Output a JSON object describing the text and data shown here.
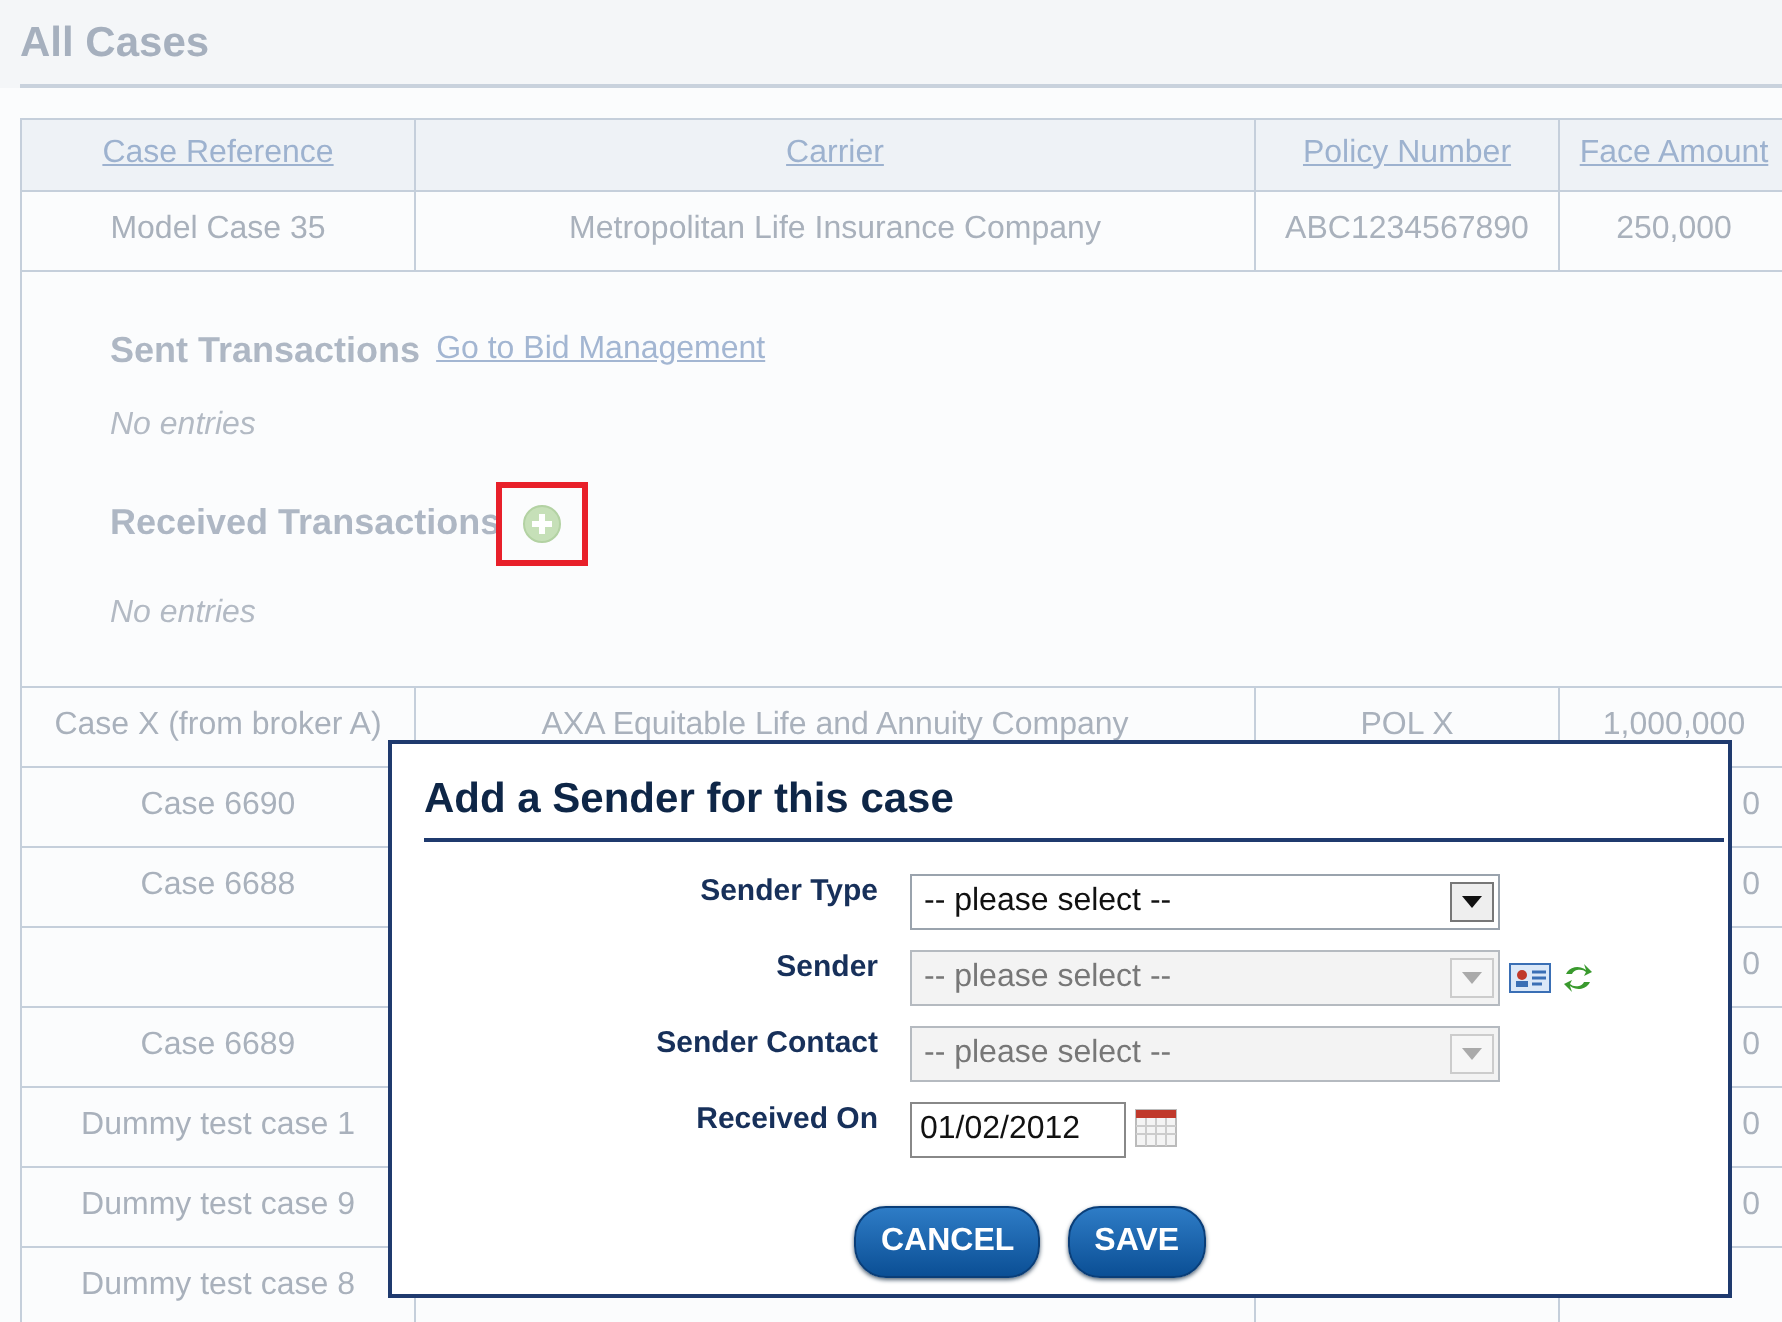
{
  "page": {
    "title": "All Cases"
  },
  "table": {
    "columns": [
      {
        "label": "Case Reference"
      },
      {
        "label": "Carrier"
      },
      {
        "label": "Policy Number"
      },
      {
        "label": "Face Amount"
      }
    ],
    "rows": [
      {
        "kind": "case",
        "cells": [
          "Model Case 35",
          "Metropolitan Life Insurance Company",
          "ABC1234567890",
          "250,000"
        ]
      },
      {
        "kind": "detail",
        "sections": [
          {
            "heading": "Sent Transactions",
            "kind": "link",
            "link": "Go to Bid Management",
            "empty_text": "No entries",
            "highlighted": false
          },
          {
            "heading": "Received Transactions",
            "kind": "add",
            "empty_text": "No entries",
            "highlighted": true
          }
        ]
      },
      {
        "kind": "case",
        "cells": [
          "Case X (from broker A)",
          "AXA Equitable Life and Annuity Company",
          "POL X",
          "1,000,000"
        ]
      },
      {
        "kind": "partial",
        "case_reference": "Case 6690",
        "face_amount": "0"
      },
      {
        "kind": "partial",
        "case_reference": "Case 6688",
        "face_amount": "0"
      },
      {
        "kind": "partial",
        "face_amount": "0"
      },
      {
        "kind": "partial",
        "case_reference": "Case 6689",
        "face_amount": "0"
      },
      {
        "kind": "partial",
        "case_reference": "Dummy test case 1",
        "face_amount": "0"
      },
      {
        "kind": "partial",
        "case_reference": "Dummy test case 9",
        "face_amount": "0"
      },
      {
        "kind": "partial",
        "case_reference": "Dummy test case 8"
      }
    ]
  },
  "dialog": {
    "title": "Add a Sender for this case",
    "fields": [
      {
        "label": "Sender Type",
        "kind": "select",
        "value": "-- please select --",
        "disabled": false
      },
      {
        "label": "Sender",
        "kind": "select-lookup",
        "value": "-- please select --",
        "disabled": true
      },
      {
        "label": "Sender Contact",
        "kind": "select",
        "value": "-- please select --",
        "disabled": true
      },
      {
        "label": "Received On",
        "kind": "date",
        "value": "01/02/2012",
        "disabled": false
      }
    ],
    "buttons": [
      "CANCEL",
      "SAVE"
    ]
  }
}
